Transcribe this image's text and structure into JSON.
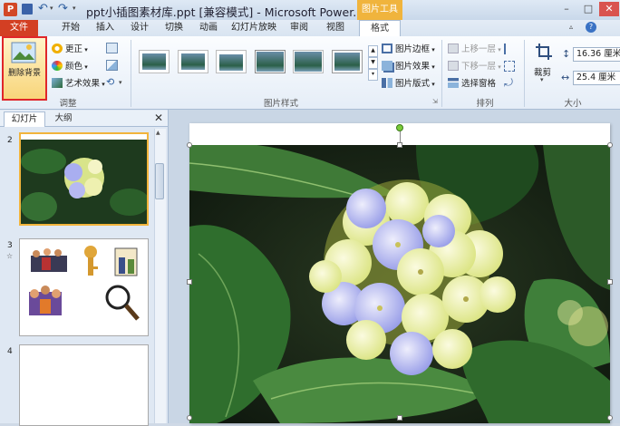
{
  "window": {
    "title": "ppt小插图素材库.ppt [兼容模式] - Microsoft Power...",
    "context_tab_group": "图片工具",
    "controls": {
      "minimize": "–",
      "maximize": "□",
      "close": "✕"
    }
  },
  "quick_access": {
    "save_icon": "save-icon",
    "undo_icon": "undo-icon",
    "redo_icon": "redo-icon"
  },
  "tabs": [
    {
      "label": "文件"
    },
    {
      "label": "开始"
    },
    {
      "label": "插入"
    },
    {
      "label": "设计"
    },
    {
      "label": "切换"
    },
    {
      "label": "动画"
    },
    {
      "label": "幻灯片放映"
    },
    {
      "label": "审阅"
    },
    {
      "label": "视图"
    },
    {
      "label": "格式"
    }
  ],
  "ribbon": {
    "adjust": {
      "label": "调整",
      "remove_background": "删除背景",
      "corrections": "更正",
      "color": "颜色",
      "artistic_effects": "艺术效果"
    },
    "picture_styles": {
      "label": "图片样式",
      "border": "图片边框",
      "effects": "图片效果",
      "layout": "图片版式"
    },
    "arrange": {
      "label": "排列",
      "bring_forward": "上移一层",
      "send_backward": "下移一层",
      "selection_pane": "选择窗格"
    },
    "size": {
      "label": "大小",
      "crop": "裁剪",
      "height": "16.36 厘米",
      "width": "25.4 厘米"
    }
  },
  "pane": {
    "tabs": [
      {
        "label": "幻灯片"
      },
      {
        "label": "大纲"
      }
    ],
    "close": "✕",
    "slides": [
      {
        "number": "2"
      },
      {
        "number": "3"
      },
      {
        "number": "4"
      }
    ]
  },
  "colors": {
    "file_tab": "#d33f23",
    "context_tab": "#f0b43d",
    "highlight": "#e0262a"
  }
}
